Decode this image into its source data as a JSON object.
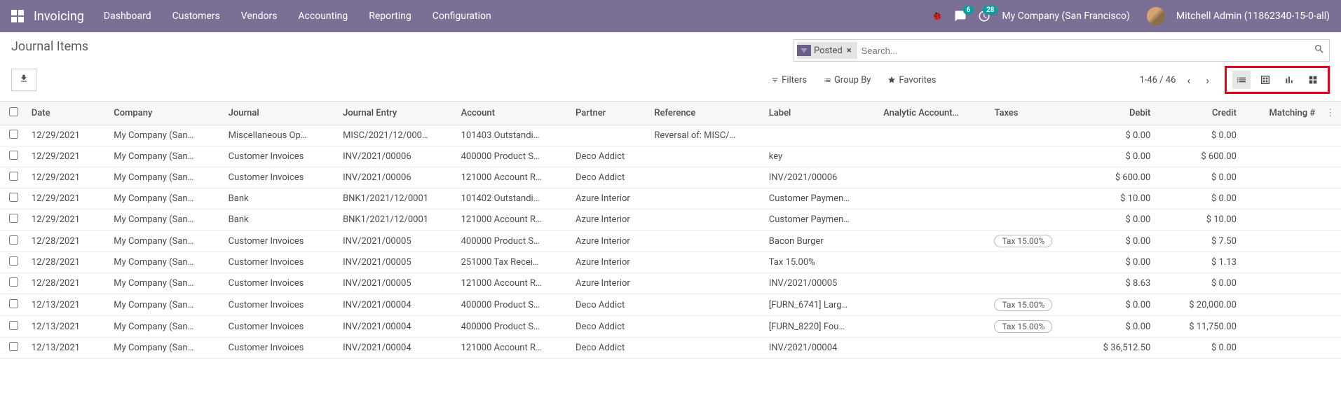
{
  "nav": {
    "brand": "Invoicing",
    "items": [
      "Dashboard",
      "Customers",
      "Vendors",
      "Accounting",
      "Reporting",
      "Configuration"
    ],
    "messages_badge": "6",
    "activities_badge": "28",
    "company": "My Company (San Francisco)",
    "user": "Mitchell Admin (11862340-15-0-all)"
  },
  "breadcrumb": "Journal Items",
  "search": {
    "filter_chip": "Posted",
    "placeholder": "Search..."
  },
  "toolbar": {
    "filters": "Filters",
    "groupby": "Group By",
    "favorites": "Favorites",
    "pager": "1-46 / 46"
  },
  "columns": {
    "date": "Date",
    "company": "Company",
    "journal": "Journal",
    "entry": "Journal Entry",
    "account": "Account",
    "partner": "Partner",
    "reference": "Reference",
    "label": "Label",
    "analytic": "Analytic Account…",
    "taxes": "Taxes",
    "debit": "Debit",
    "credit": "Credit",
    "matching": "Matching #"
  },
  "rows": [
    {
      "date": "12/29/2021",
      "company": "My Company (San…",
      "journal": "Miscellaneous Op…",
      "entry": "MISC/2021/12/000…",
      "account": "101403 Outstandi…",
      "partner": "",
      "reference": "Reversal of: MISC/…",
      "label": "",
      "analytic": "",
      "taxes": "",
      "debit": "$ 0.00",
      "credit": "$ 0.00",
      "matching": ""
    },
    {
      "date": "12/29/2021",
      "company": "My Company (San…",
      "journal": "Customer Invoices",
      "entry": "INV/2021/00006",
      "account": "400000 Product S…",
      "partner": "Deco Addict",
      "reference": "",
      "label": "key",
      "analytic": "",
      "taxes": "",
      "debit": "$ 0.00",
      "credit": "$ 600.00",
      "matching": ""
    },
    {
      "date": "12/29/2021",
      "company": "My Company (San…",
      "journal": "Customer Invoices",
      "entry": "INV/2021/00006",
      "account": "121000 Account R…",
      "partner": "Deco Addict",
      "reference": "",
      "label": "INV/2021/00006",
      "analytic": "",
      "taxes": "",
      "debit": "$ 600.00",
      "credit": "$ 0.00",
      "matching": ""
    },
    {
      "date": "12/29/2021",
      "company": "My Company (San…",
      "journal": "Bank",
      "entry": "BNK1/2021/12/0001",
      "account": "101402 Outstandi…",
      "partner": "Azure Interior",
      "reference": "",
      "label": "Customer Paymen…",
      "analytic": "",
      "taxes": "",
      "debit": "$ 10.00",
      "credit": "$ 0.00",
      "matching": ""
    },
    {
      "date": "12/29/2021",
      "company": "My Company (San…",
      "journal": "Bank",
      "entry": "BNK1/2021/12/0001",
      "account": "121000 Account R…",
      "partner": "Azure Interior",
      "reference": "",
      "label": "Customer Paymen…",
      "analytic": "",
      "taxes": "",
      "debit": "$ 0.00",
      "credit": "$ 10.00",
      "matching": ""
    },
    {
      "date": "12/28/2021",
      "company": "My Company (San…",
      "journal": "Customer Invoices",
      "entry": "INV/2021/00005",
      "account": "400000 Product S…",
      "partner": "Azure Interior",
      "reference": "",
      "label": "Bacon Burger",
      "analytic": "",
      "taxes": "Tax 15.00%",
      "debit": "$ 0.00",
      "credit": "$ 7.50",
      "matching": ""
    },
    {
      "date": "12/28/2021",
      "company": "My Company (San…",
      "journal": "Customer Invoices",
      "entry": "INV/2021/00005",
      "account": "251000 Tax Recei…",
      "partner": "Azure Interior",
      "reference": "",
      "label": "Tax 15.00%",
      "analytic": "",
      "taxes": "",
      "debit": "$ 0.00",
      "credit": "$ 1.13",
      "matching": ""
    },
    {
      "date": "12/28/2021",
      "company": "My Company (San…",
      "journal": "Customer Invoices",
      "entry": "INV/2021/00005",
      "account": "121000 Account R…",
      "partner": "Azure Interior",
      "reference": "",
      "label": "INV/2021/00005",
      "analytic": "",
      "taxes": "",
      "debit": "$ 8.63",
      "credit": "$ 0.00",
      "matching": ""
    },
    {
      "date": "12/13/2021",
      "company": "My Company (San…",
      "journal": "Customer Invoices",
      "entry": "INV/2021/00004",
      "account": "400000 Product S…",
      "partner": "Deco Addict",
      "reference": "",
      "label": "[FURN_6741] Larg…",
      "analytic": "",
      "taxes": "Tax 15.00%",
      "debit": "$ 0.00",
      "credit": "$ 20,000.00",
      "matching": ""
    },
    {
      "date": "12/13/2021",
      "company": "My Company (San…",
      "journal": "Customer Invoices",
      "entry": "INV/2021/00004",
      "account": "400000 Product S…",
      "partner": "Deco Addict",
      "reference": "",
      "label": "[FURN_8220] Fou…",
      "analytic": "",
      "taxes": "Tax 15.00%",
      "debit": "$ 0.00",
      "credit": "$ 11,750.00",
      "matching": ""
    },
    {
      "date": "12/13/2021",
      "company": "My Company (San…",
      "journal": "Customer Invoices",
      "entry": "INV/2021/00004",
      "account": "121000 Account R…",
      "partner": "Deco Addict",
      "reference": "",
      "label": "INV/2021/00004",
      "analytic": "",
      "taxes": "",
      "debit": "$ 36,512.50",
      "credit": "$ 0.00",
      "matching": ""
    }
  ]
}
